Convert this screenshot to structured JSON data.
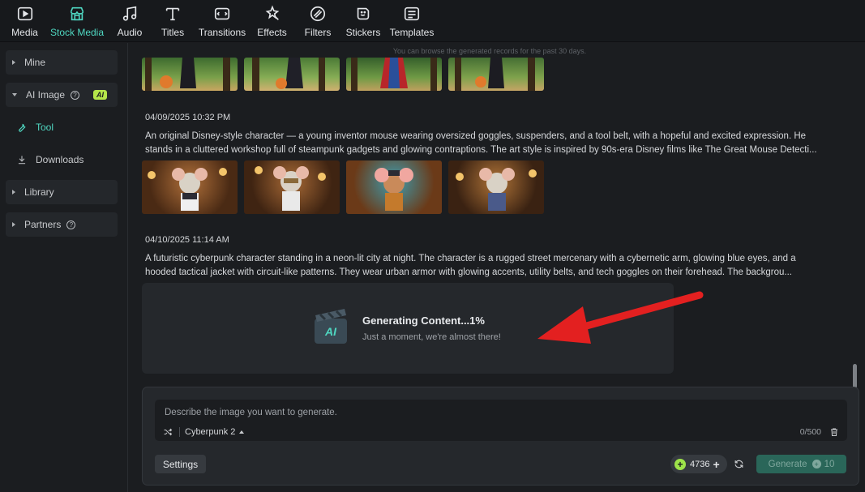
{
  "toolbar": {
    "items": [
      {
        "label": "Media",
        "icon": "media-icon"
      },
      {
        "label": "Stock Media",
        "icon": "stock-media-icon",
        "active": true
      },
      {
        "label": "Audio",
        "icon": "music-note-icon"
      },
      {
        "label": "Titles",
        "icon": "text-t-icon"
      },
      {
        "label": "Transitions",
        "icon": "transitions-icon"
      },
      {
        "label": "Effects",
        "icon": "effects-sparkle-icon"
      },
      {
        "label": "Filters",
        "icon": "filters-icon"
      },
      {
        "label": "Stickers",
        "icon": "stickers-icon"
      },
      {
        "label": "Templates",
        "icon": "templates-icon"
      }
    ],
    "accent": "#4fd7c1"
  },
  "sidebar": {
    "mine": "Mine",
    "ai_image": "AI Image",
    "ai_badge": "AI",
    "help_glyph": "?",
    "tool": "Tool",
    "downloads": "Downloads",
    "library": "Library",
    "partners": "Partners"
  },
  "main": {
    "notice": "You can browse the generated records for the past 30 days.",
    "records": [
      {
        "date": "04/09/2025 10:32 PM",
        "prompt_line1": "An original Disney-style character — a young inventor mouse wearing oversized goggles, suspenders, and a tool belt, with a hopeful and excited expression. He",
        "prompt_line2": "stands in a cluttered workshop full of steampunk gadgets and glowing contraptions. The art style is inspired by 90s-era Disney films like The Great Mouse Detecti..."
      },
      {
        "date": "04/10/2025 11:14 AM",
        "prompt_line1": "A futuristic cyberpunk character standing in a neon-lit city at night. The character is a rugged street mercenary with a cybernetic arm, glowing blue eyes, and a",
        "prompt_line2": "hooded tactical jacket with circuit-like patterns. They wear urban armor with glowing accents, utility belts, and tech goggles on their forehead. The backgrou..."
      }
    ],
    "generating": {
      "title": "Generating Content...1%",
      "subtitle": "Just a moment, we're almost there!",
      "icon_text": "AI",
      "progress_percent": 1
    }
  },
  "panel": {
    "placeholder": "Describe the image you want to generate.",
    "style": "Cyberpunk 2",
    "counter": "0/500",
    "settings": "Settings",
    "credits": "4736",
    "credits_plus": "+",
    "coin_glyph": "+",
    "generate": "Generate",
    "generate_cost": "10",
    "generate_color": "#2a6659"
  }
}
